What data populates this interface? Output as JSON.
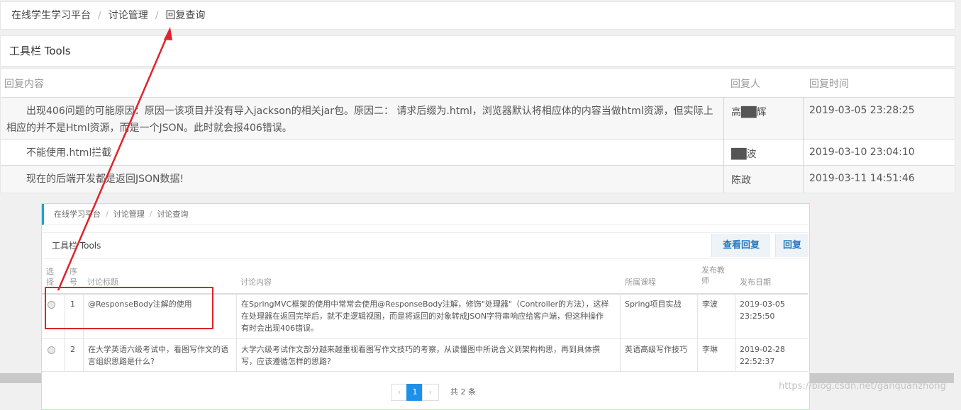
{
  "breadcrumb": [
    "在线学生学习平台",
    "讨论管理",
    "回复查询"
  ],
  "breadcrumb_sep": "/",
  "tools_title": "工具栏 Tools",
  "reply_table": {
    "headers": {
      "content": "回复内容",
      "user": "回复人",
      "time": "回复时间"
    },
    "rows": [
      {
        "content": "出现406问题的可能原因：原因一该项目并没有导入jackson的相关jar包。原因二： 请求后缀为.html，浏览器默认将相应体的内容当做html资源，但实际上相应的并不是Html资源，而是一个JSON。此时就会报406错误。",
        "user": "高██辉",
        "time": "2019-03-05 23:28:25"
      },
      {
        "content": "不能使用.html拦截",
        "user": "██波",
        "time": "2019-03-10 23:04:10"
      },
      {
        "content": "现在的后端开发都是返回JSON数据!",
        "user": "陈政",
        "time": "2019-03-11 14:51:46"
      }
    ]
  },
  "inner": {
    "breadcrumb": [
      "在线学习平台",
      "讨论管理",
      "讨论查询"
    ],
    "tools_title": "工具栏 Tools",
    "btn_view_reply": "查看回复",
    "btn_reply": "回复",
    "headers": {
      "select": "选择",
      "num": "序号",
      "title": "讨论标题",
      "content": "讨论内容",
      "course": "所属课程",
      "teacher": "发布教师",
      "date": "发布日期"
    },
    "rows": [
      {
        "num": "1",
        "title": "@ResponseBody注解的使用",
        "content": "在SpringMVC框架的使用中常常会使用@ResponseBody注解，修饰\"处理器\"（Controller的方法），这样在处理器在返回完毕后，就不走逻辑视图，而是将返回的对象转成JSON字符串响应给客户端，但这种操作有时会出现406错误。",
        "course": "Spring项目实战",
        "teacher": "李波",
        "date": "2019-03-05 23:25:50"
      },
      {
        "num": "2",
        "title": "在大学英语六级考试中，看图写作文的语言组织思路是什么?",
        "content": "大学六级考试作文部分越来越重视看图写作文技巧的考察，从读懂图中所说含义到架构构思，再到具体撰写，应该遵循怎样的思路?",
        "course": "英语高级写作技巧",
        "teacher": "李琳",
        "date": "2019-02-28 22:52:37"
      }
    ],
    "pager": {
      "prev": "‹",
      "current": "1",
      "next": "›",
      "total": "共 2 条"
    }
  },
  "watermark": "https://blog.csdn.net/ganquanzhong",
  "colors": {
    "arrow": "#e0222a",
    "accent": "#1e90e8",
    "inner_border": "#b8ecc0"
  }
}
